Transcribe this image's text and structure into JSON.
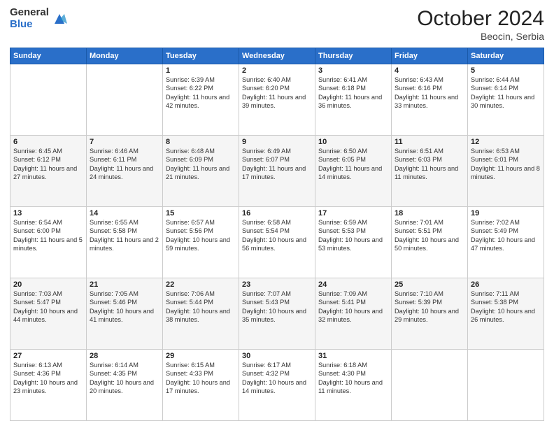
{
  "logo": {
    "general": "General",
    "blue": "Blue"
  },
  "header": {
    "month": "October 2024",
    "location": "Beocin, Serbia"
  },
  "weekdays": [
    "Sunday",
    "Monday",
    "Tuesday",
    "Wednesday",
    "Thursday",
    "Friday",
    "Saturday"
  ],
  "weeks": [
    [
      {
        "day": "",
        "info": ""
      },
      {
        "day": "",
        "info": ""
      },
      {
        "day": "1",
        "info": "Sunrise: 6:39 AM\nSunset: 6:22 PM\nDaylight: 11 hours and 42 minutes."
      },
      {
        "day": "2",
        "info": "Sunrise: 6:40 AM\nSunset: 6:20 PM\nDaylight: 11 hours and 39 minutes."
      },
      {
        "day": "3",
        "info": "Sunrise: 6:41 AM\nSunset: 6:18 PM\nDaylight: 11 hours and 36 minutes."
      },
      {
        "day": "4",
        "info": "Sunrise: 6:43 AM\nSunset: 6:16 PM\nDaylight: 11 hours and 33 minutes."
      },
      {
        "day": "5",
        "info": "Sunrise: 6:44 AM\nSunset: 6:14 PM\nDaylight: 11 hours and 30 minutes."
      }
    ],
    [
      {
        "day": "6",
        "info": "Sunrise: 6:45 AM\nSunset: 6:12 PM\nDaylight: 11 hours and 27 minutes."
      },
      {
        "day": "7",
        "info": "Sunrise: 6:46 AM\nSunset: 6:11 PM\nDaylight: 11 hours and 24 minutes."
      },
      {
        "day": "8",
        "info": "Sunrise: 6:48 AM\nSunset: 6:09 PM\nDaylight: 11 hours and 21 minutes."
      },
      {
        "day": "9",
        "info": "Sunrise: 6:49 AM\nSunset: 6:07 PM\nDaylight: 11 hours and 17 minutes."
      },
      {
        "day": "10",
        "info": "Sunrise: 6:50 AM\nSunset: 6:05 PM\nDaylight: 11 hours and 14 minutes."
      },
      {
        "day": "11",
        "info": "Sunrise: 6:51 AM\nSunset: 6:03 PM\nDaylight: 11 hours and 11 minutes."
      },
      {
        "day": "12",
        "info": "Sunrise: 6:53 AM\nSunset: 6:01 PM\nDaylight: 11 hours and 8 minutes."
      }
    ],
    [
      {
        "day": "13",
        "info": "Sunrise: 6:54 AM\nSunset: 6:00 PM\nDaylight: 11 hours and 5 minutes."
      },
      {
        "day": "14",
        "info": "Sunrise: 6:55 AM\nSunset: 5:58 PM\nDaylight: 11 hours and 2 minutes."
      },
      {
        "day": "15",
        "info": "Sunrise: 6:57 AM\nSunset: 5:56 PM\nDaylight: 10 hours and 59 minutes."
      },
      {
        "day": "16",
        "info": "Sunrise: 6:58 AM\nSunset: 5:54 PM\nDaylight: 10 hours and 56 minutes."
      },
      {
        "day": "17",
        "info": "Sunrise: 6:59 AM\nSunset: 5:53 PM\nDaylight: 10 hours and 53 minutes."
      },
      {
        "day": "18",
        "info": "Sunrise: 7:01 AM\nSunset: 5:51 PM\nDaylight: 10 hours and 50 minutes."
      },
      {
        "day": "19",
        "info": "Sunrise: 7:02 AM\nSunset: 5:49 PM\nDaylight: 10 hours and 47 minutes."
      }
    ],
    [
      {
        "day": "20",
        "info": "Sunrise: 7:03 AM\nSunset: 5:47 PM\nDaylight: 10 hours and 44 minutes."
      },
      {
        "day": "21",
        "info": "Sunrise: 7:05 AM\nSunset: 5:46 PM\nDaylight: 10 hours and 41 minutes."
      },
      {
        "day": "22",
        "info": "Sunrise: 7:06 AM\nSunset: 5:44 PM\nDaylight: 10 hours and 38 minutes."
      },
      {
        "day": "23",
        "info": "Sunrise: 7:07 AM\nSunset: 5:43 PM\nDaylight: 10 hours and 35 minutes."
      },
      {
        "day": "24",
        "info": "Sunrise: 7:09 AM\nSunset: 5:41 PM\nDaylight: 10 hours and 32 minutes."
      },
      {
        "day": "25",
        "info": "Sunrise: 7:10 AM\nSunset: 5:39 PM\nDaylight: 10 hours and 29 minutes."
      },
      {
        "day": "26",
        "info": "Sunrise: 7:11 AM\nSunset: 5:38 PM\nDaylight: 10 hours and 26 minutes."
      }
    ],
    [
      {
        "day": "27",
        "info": "Sunrise: 6:13 AM\nSunset: 4:36 PM\nDaylight: 10 hours and 23 minutes."
      },
      {
        "day": "28",
        "info": "Sunrise: 6:14 AM\nSunset: 4:35 PM\nDaylight: 10 hours and 20 minutes."
      },
      {
        "day": "29",
        "info": "Sunrise: 6:15 AM\nSunset: 4:33 PM\nDaylight: 10 hours and 17 minutes."
      },
      {
        "day": "30",
        "info": "Sunrise: 6:17 AM\nSunset: 4:32 PM\nDaylight: 10 hours and 14 minutes."
      },
      {
        "day": "31",
        "info": "Sunrise: 6:18 AM\nSunset: 4:30 PM\nDaylight: 10 hours and 11 minutes."
      },
      {
        "day": "",
        "info": ""
      },
      {
        "day": "",
        "info": ""
      }
    ]
  ]
}
